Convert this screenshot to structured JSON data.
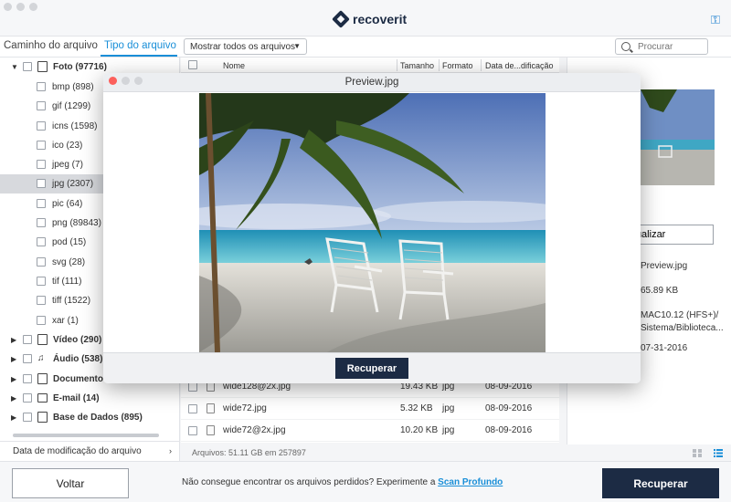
{
  "app": {
    "name": "recoverit",
    "brand_color": "#1c2b44",
    "accent_color": "#1a8fd8"
  },
  "tabs": [
    {
      "label": "Caminho do arquivo",
      "active": false
    },
    {
      "label": "Tipo do arquivo",
      "active": true
    }
  ],
  "filter": {
    "label": "Mostrar todos os arquivos"
  },
  "search": {
    "placeholder": "Procurar"
  },
  "tree": {
    "foto": {
      "label": "Foto (97716)",
      "icon": "photo-icon"
    },
    "foto_children": [
      {
        "label": "bmp (898)"
      },
      {
        "label": "gif (1299)"
      },
      {
        "label": "icns (1598)"
      },
      {
        "label": "ico (23)"
      },
      {
        "label": "jpeg (7)"
      },
      {
        "label": "jpg (2307)",
        "selected": true
      },
      {
        "label": "pic (64)"
      },
      {
        "label": "png (89843)"
      },
      {
        "label": "pod (15)"
      },
      {
        "label": "svg (28)"
      },
      {
        "label": "tif (111)"
      },
      {
        "label": "tiff (1522)"
      },
      {
        "label": "xar (1)"
      }
    ],
    "categories": [
      {
        "label": "Vídeo (290)",
        "icon": "video-icon"
      },
      {
        "label": "Áudio (538)",
        "icon": "audio-icon"
      },
      {
        "label": "Documento (",
        "icon": "document-icon"
      },
      {
        "label": "E-mail (14)",
        "icon": "email-icon"
      },
      {
        "label": "Base de Dados (895)",
        "icon": "database-icon"
      }
    ]
  },
  "sidebar_footer": {
    "label": "Data de modificação do arquivo"
  },
  "list": {
    "columns": {
      "name": "Nome",
      "size": "Tamanho",
      "format": "Formato",
      "date": "Data de...dificação"
    },
    "rows": [
      {
        "name": "wide128@2x.jpg",
        "size": "19.43 KB",
        "format": "jpg",
        "date": "08-09-2016"
      },
      {
        "name": "wide72.jpg",
        "size": "5.32 KB",
        "format": "jpg",
        "date": "08-09-2016"
      },
      {
        "name": "wide72@2x.jpg",
        "size": "10.20 KB",
        "format": "jpg",
        "date": "08-09-2016"
      }
    ],
    "summary": "Arquivos: 51.11 GB em 257897"
  },
  "details": {
    "preview_button": "isualizar",
    "name": "Preview.jpg",
    "size": "65.89 KB",
    "path_line1": "MAC10.12 (HFS+)/",
    "path_line2": "Sistema/Biblioteca...",
    "date": "07-31-2016"
  },
  "modal": {
    "title": "Preview.jpg",
    "recover_button": "Recuperar"
  },
  "bottom": {
    "back_button": "Voltar",
    "message": "Não consegue encontrar os arquivos perdidos? Experimente a ",
    "deep_scan_link": "Scan Profundo",
    "recover_button": "Recuperar"
  }
}
